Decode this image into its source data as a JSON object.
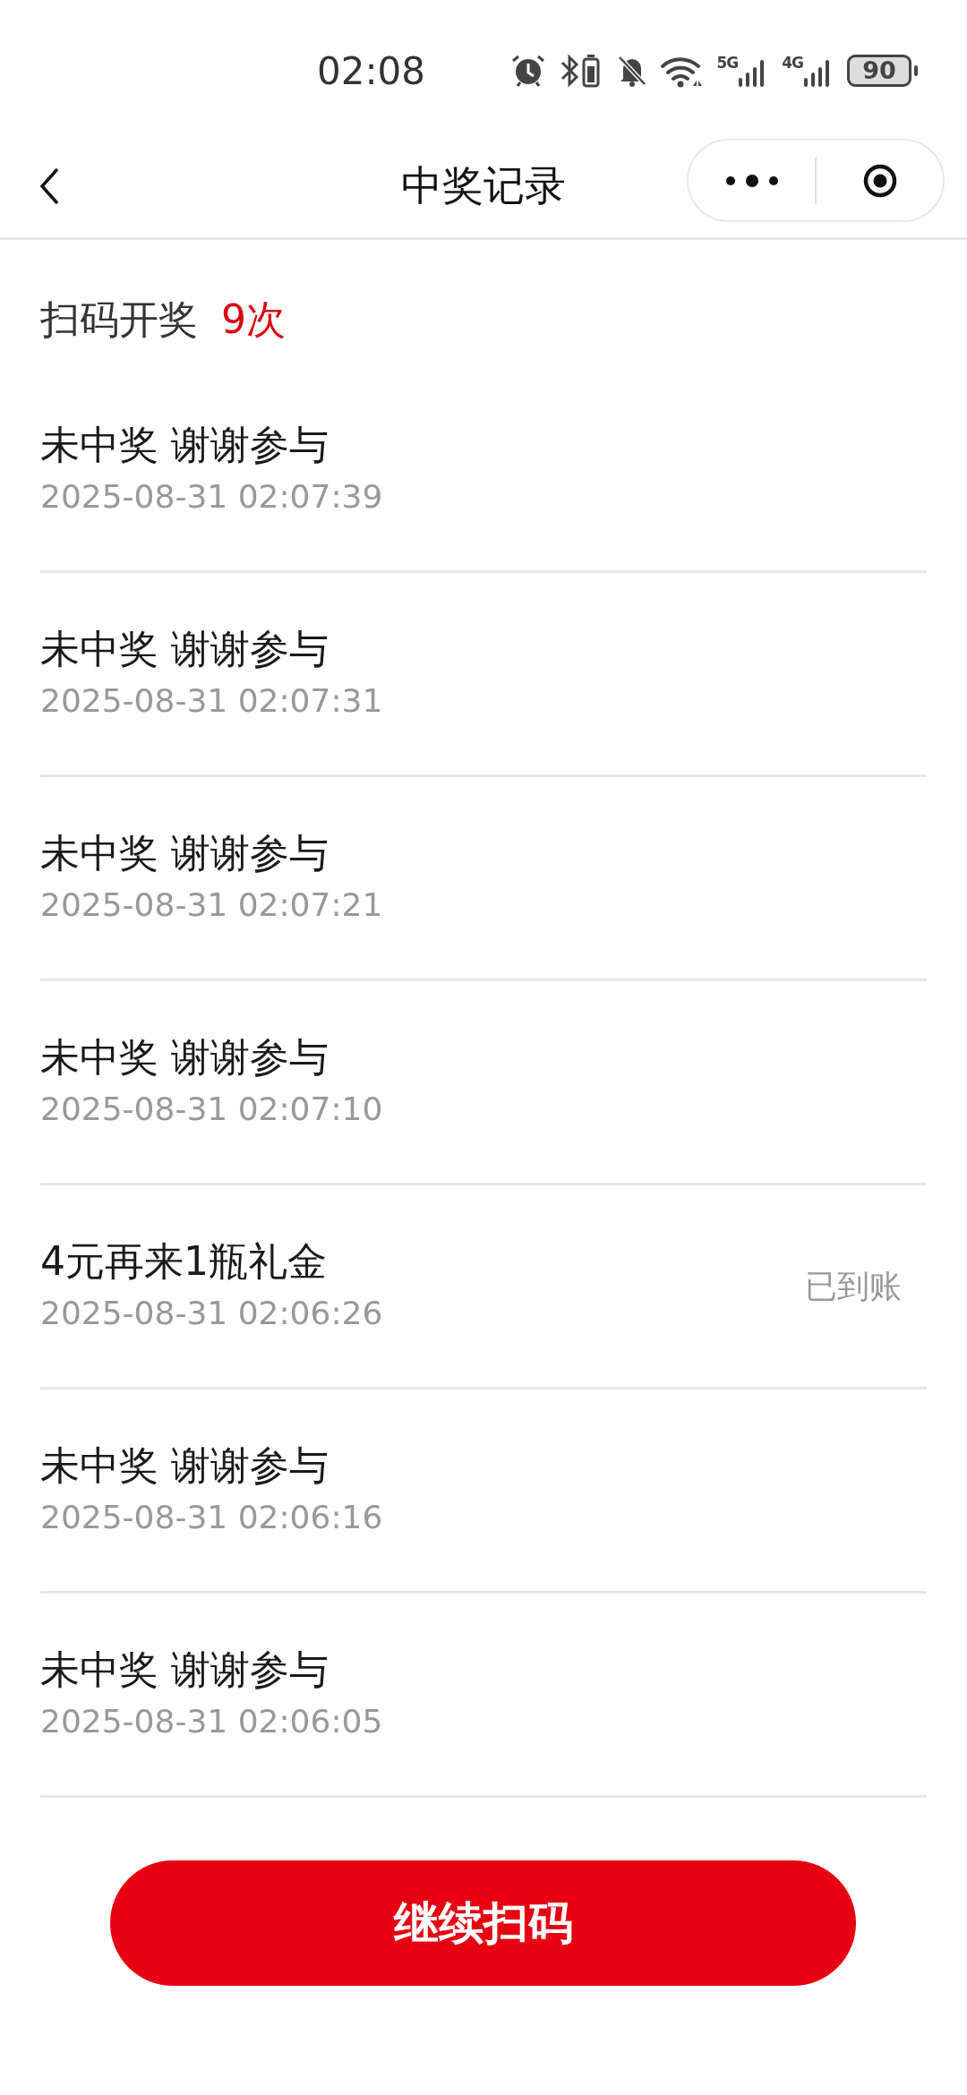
{
  "status_bar": {
    "time": "02:08",
    "battery": "90",
    "network_1": "5G",
    "network_2": "4G"
  },
  "nav": {
    "title": "中奖记录"
  },
  "summary": {
    "label": "扫码开奖",
    "count": "9次"
  },
  "records": [
    {
      "title": "未中奖 谢谢参与",
      "time": "2025-08-31 02:07:39"
    },
    {
      "title": "未中奖 谢谢参与",
      "time": "2025-08-31 02:07:31"
    },
    {
      "title": "未中奖 谢谢参与",
      "time": "2025-08-31 02:07:21"
    },
    {
      "title": "未中奖 谢谢参与",
      "time": "2025-08-31 02:07:10"
    },
    {
      "title": "4元再来1瓶礼金",
      "time": "2025-08-31 02:06:26",
      "status": "已到账"
    },
    {
      "title": "未中奖 谢谢参与",
      "time": "2025-08-31 02:06:16"
    },
    {
      "title": "未中奖 谢谢参与",
      "time": "2025-08-31 02:06:05"
    }
  ],
  "button": "继续扫码"
}
